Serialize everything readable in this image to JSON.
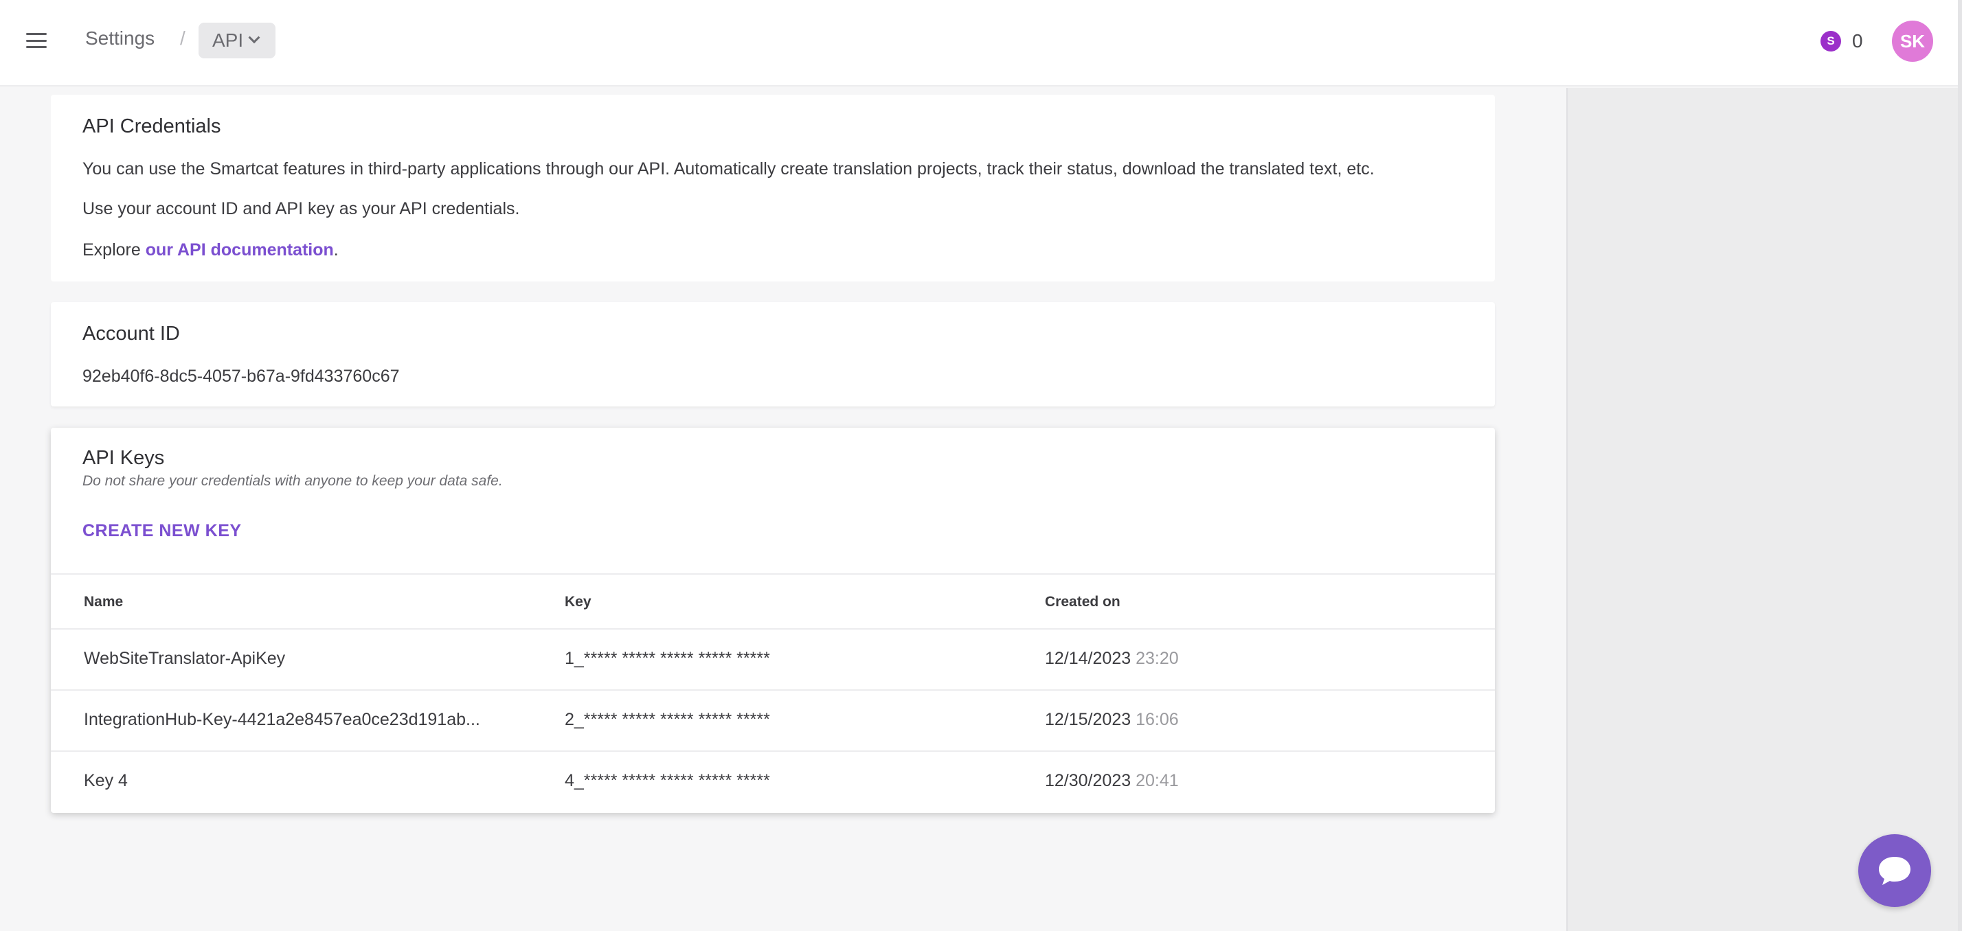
{
  "header": {
    "breadcrumb_settings": "Settings",
    "breadcrumb_separator": "/",
    "breadcrumb_current": "API",
    "balance_icon_letter": "S",
    "balance_value": "0",
    "avatar_initials": "SK",
    "accent_color": "#9b2fc9"
  },
  "credentials": {
    "title": "API Credentials",
    "paragraph1": "You can use the Smartcat features in third-party applications through our API. Automatically create translation projects, track their status, download the translated text, etc.",
    "paragraph2": "Use your account ID and API key as your API credentials.",
    "explore_prefix": "Explore ",
    "explore_link": "our API documentation",
    "explore_suffix": "."
  },
  "account": {
    "title": "Account ID",
    "id": "92eb40f6-8dc5-4057-b67a-9fd433760c67"
  },
  "keys": {
    "title": "API Keys",
    "subtitle": "Do not share your credentials with anyone to keep your data safe.",
    "create_label": "CREATE NEW KEY",
    "columns": [
      "Name",
      "Key",
      "Created on"
    ],
    "rows": [
      {
        "name": "WebSiteTranslator-ApiKey",
        "key": "1_***** ***** ***** ***** *****",
        "date": "12/14/2023",
        "time": "23:20"
      },
      {
        "name": "IntegrationHub-Key-4421a2e8457ea0ce23d191ab...",
        "key": "2_***** ***** ***** ***** *****",
        "date": "12/15/2023",
        "time": "16:06"
      },
      {
        "name": "Key 4",
        "key": "4_***** ***** ***** ***** *****",
        "date": "12/30/2023",
        "time": "20:41"
      }
    ]
  },
  "icons": {
    "menu": "hamburger-menu-icon",
    "chevron": "chevron-down-icon",
    "chat": "chat-bubble-icon"
  },
  "colors": {
    "link": "#7b4fd0",
    "avatar": "#e07ad8",
    "chat": "#7d5bc8"
  }
}
